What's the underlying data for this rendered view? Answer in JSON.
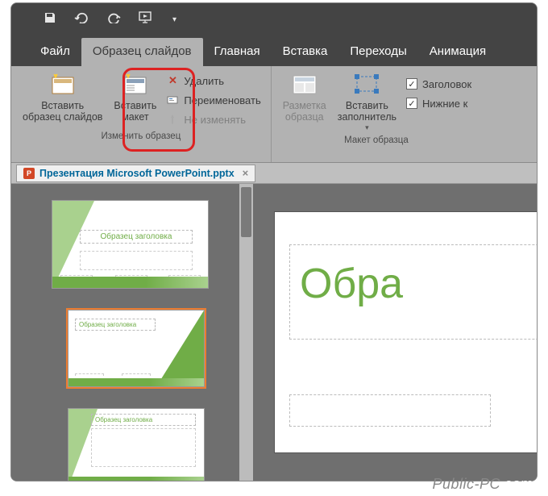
{
  "qat": {
    "save": "save",
    "undo": "undo",
    "redo": "redo",
    "startshow": "start-from-beginning"
  },
  "tabs": {
    "file": "Файл",
    "slidemaster": "Образец слайдов",
    "home": "Главная",
    "insert": "Вставка",
    "transitions": "Переходы",
    "animations": "Анимация"
  },
  "ribbon": {
    "insert_master": "Вставить\nобразец слайдов",
    "insert_layout": "Вставить\nмакет",
    "delete": "Удалить",
    "rename": "Переименовать",
    "preserve": "Не изменять",
    "group_edit": "Изменить образец",
    "master_layout": "Разметка\nобразца",
    "insert_placeholder": "Вставить\nзаполнитель",
    "chk_title": "Заголовок",
    "chk_footers": "Нижние к",
    "group_layout": "Макет образца"
  },
  "doc": {
    "filename": "Презентация Microsoft PowerPoint.pptx"
  },
  "thumbs": {
    "master_title": "Образец заголовка",
    "layout_title": "Образец заголовка"
  },
  "slide": {
    "title_fragment": "Обра"
  },
  "watermark": "Public-PC.com"
}
